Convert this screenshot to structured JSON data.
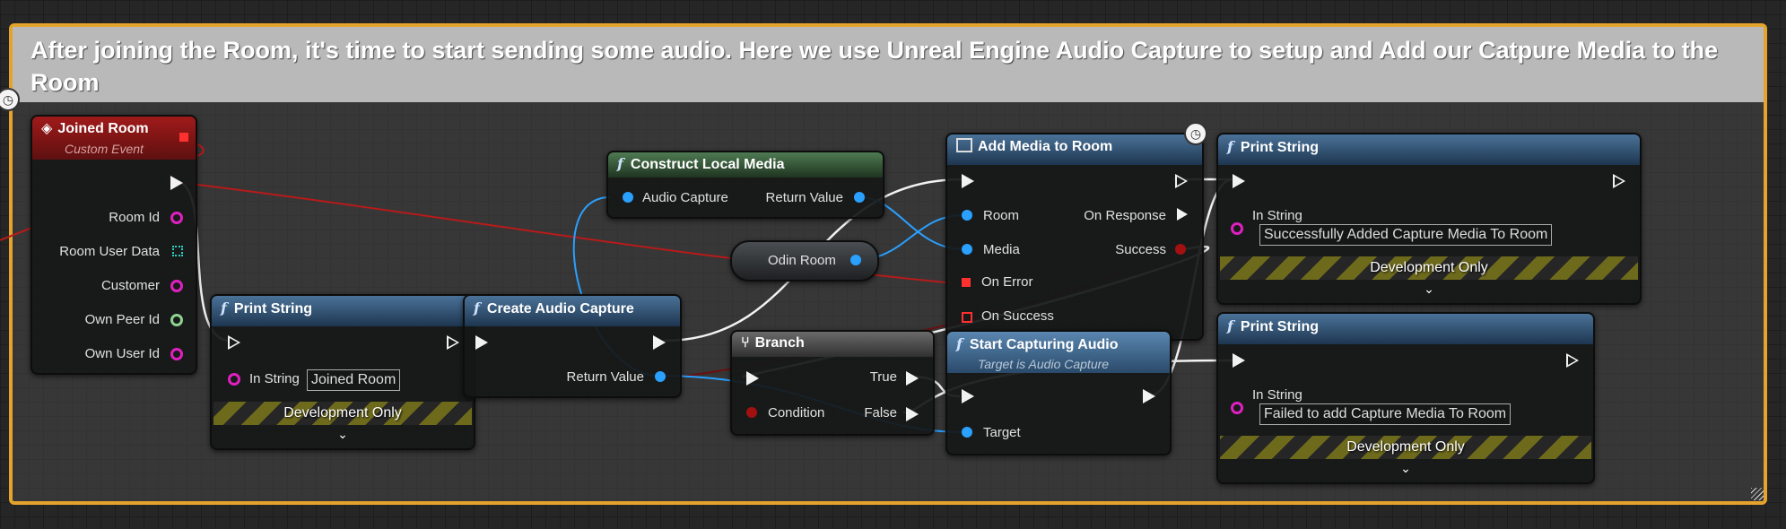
{
  "comment": {
    "title": "After joining the Room, it's time to start sending some audio. Here we use Unreal Engine Audio Capture to setup and Add our Catpure Media to the Room"
  },
  "nodes": {
    "joined_room": {
      "title": "Joined Room",
      "subtitle": "Custom Event",
      "pins": [
        "Room Id",
        "Room User Data",
        "Customer",
        "Own Peer Id",
        "Own User Id"
      ]
    },
    "print_string_1": {
      "title": "Print String",
      "in_label": "In String",
      "value": "Joined Room",
      "dev": "Development Only"
    },
    "create_audio_capture": {
      "title": "Create Audio Capture",
      "return_label": "Return Value"
    },
    "construct_local_media": {
      "title": "Construct Local Media",
      "in_label": "Audio Capture",
      "return_label": "Return Value"
    },
    "odin_room": {
      "title": "Odin Room"
    },
    "add_media": {
      "title": "Add Media to Room",
      "room": "Room",
      "media": "Media",
      "on_error": "On Error",
      "on_success": "On Success",
      "on_response": "On Response",
      "success": "Success"
    },
    "branch": {
      "title": "Branch",
      "condition": "Condition",
      "true_label": "True",
      "false_label": "False"
    },
    "start_capturing": {
      "title": "Start Capturing Audio",
      "subtitle": "Target is Audio Capture",
      "target": "Target"
    },
    "print_string_2": {
      "title": "Print String",
      "in_label": "In String",
      "value": "Successfully Added Capture Media To Room",
      "dev": "Development Only"
    },
    "print_string_3": {
      "title": "Print String",
      "in_label": "In String",
      "value": "Failed to add Capture Media To Room",
      "dev": "Development Only"
    }
  },
  "icons": {
    "function": "f",
    "event": "diamond-icon",
    "branch": "branch-icon",
    "add_media": "window-icon",
    "latent": "clock-icon",
    "chevron": "⌄"
  },
  "colors": {
    "comment_border": "#e4a42c",
    "event_header": "#8b1414",
    "function_header": "#34587c",
    "pure_header": "#3a5a3a",
    "exec_wire": "#f2f2f2",
    "object_wire": "#2aa0ff",
    "red_wire": "#b81a1a"
  }
}
